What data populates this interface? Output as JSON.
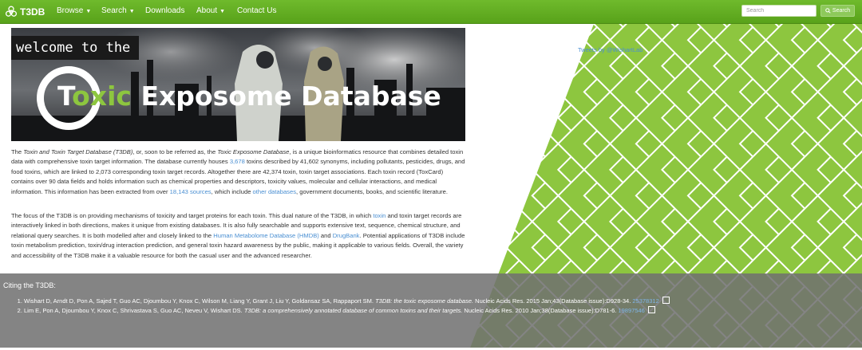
{
  "brand": {
    "name": "T3DB",
    "icon": "biohazard-icon"
  },
  "nav": {
    "browse": "Browse",
    "search": "Search",
    "downloads": "Downloads",
    "about": "About",
    "contact": "Contact Us"
  },
  "search": {
    "placeholder": "Search",
    "button": "Search"
  },
  "banner": {
    "welcome": "welcome to the",
    "logo_letter": "T",
    "logo_word": "oxic",
    "title_rest": " Exposome Database"
  },
  "intro": {
    "p1": {
      "a": "The ",
      "b": "Toxin and Toxin Target Database (T3DB)",
      "c": ", or, soon to be referred as, the ",
      "d": "Toxic Exposome Database",
      "e": ", is a unique bioinformatics resource that combines detailed toxin data with comprehensive toxin target information. The database currently houses ",
      "f": "3,678",
      "g": " toxins described by 41,602 synonyms, including pollutants, pesticides, drugs, and food toxins, which are linked to 2,073 corresponding toxin target records. Altogether there are 42,374 toxin, toxin target associations. Each toxin record (ToxCard) contains over 90 data fields and holds information such as chemical properties and descriptors, toxicity values, molecular and cellular interactions, and medical information. This information has been extracted from over ",
      "h": "18,143 sources",
      "i": ", which include ",
      "j": "other databases",
      "k": ", government documents, books, and scientific literature."
    },
    "p2": {
      "a": "The focus of the T3DB is on providing mechanisms of toxicity and target proteins for each toxin. This dual nature of the T3DB, in which ",
      "b": "toxin",
      "c": " and toxin target records are interactively linked in both directions, makes it unique from existing databases. It is also fully searchable and supports extensive text, sequence, chemical structure, and relational query searches. It is both modelled after and closely linked to the ",
      "d": "Human Metabolome Database (HMDB)",
      "e": " and ",
      "f": "DrugBank",
      "g": ". Potential applications of T3DB include toxin metabolism prediction, toxin/drug interaction prediction, and general toxin hazard awareness by the public, making it applicable to various fields. Overall, the variety and accessibility of the T3DB make it a valuable resource for both the casual user and the advanced researcher."
    }
  },
  "tweets": {
    "label": "Tweets by @WishartLab"
  },
  "citing": {
    "title": "Citing the T3DB:",
    "items": [
      {
        "authors": "Wishart D, Arndt D, Pon A, Sajed T, Guo AC, Djoumbou Y, Knox C, Wilson M, Liang Y, Grant J, Liu Y, Goldansaz SA, Rappaport SM. ",
        "title": "T3DB: the toxic exposome database.",
        "source": " Nucleic Acids Res. 2015 Jan;43(Database issue):D928-34. ",
        "link": "25378312"
      },
      {
        "authors": "Lim E, Pon A, Djoumbou Y, Knox C, Shrivastava S, Guo AC, Neveu V, Wishart DS. ",
        "title": "T3DB: a comprehensively annotated database of common toxins and their targets.",
        "source": " Nucleic Acids Res. 2010 Jan;38(Database issue):D781-6. ",
        "link": "19897546"
      }
    ]
  },
  "colors": {
    "nav_green": "#6fba2c",
    "pattern_green": "#8dc63f",
    "link_blue": "#4a8fd2",
    "citation_band": "#707070"
  }
}
